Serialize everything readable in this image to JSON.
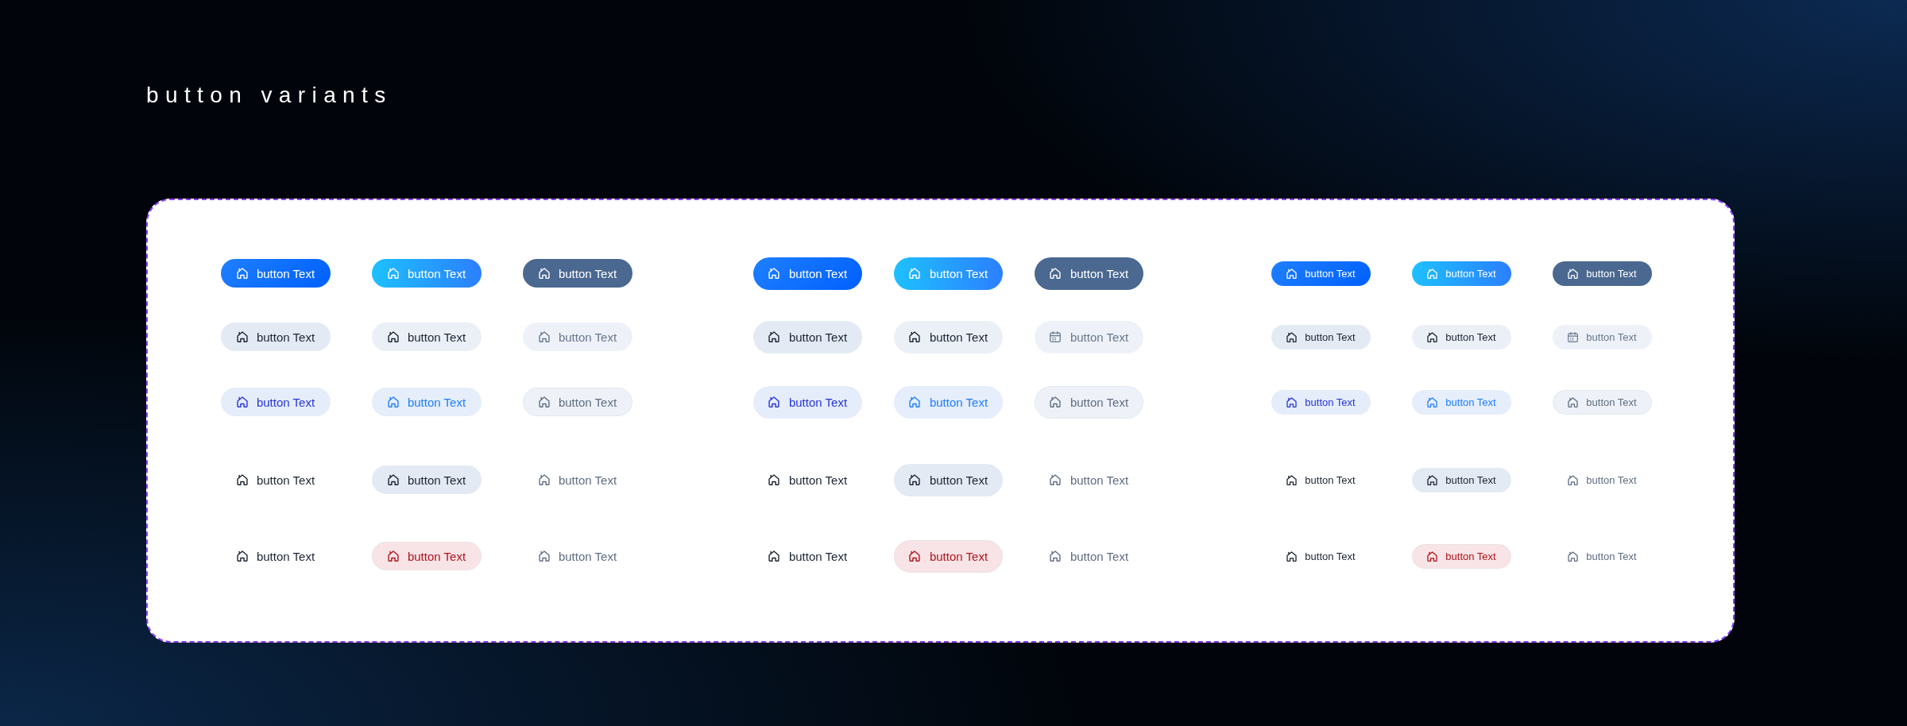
{
  "title": "button variants",
  "groups": [
    {
      "kind": "medium",
      "rows": [
        {
          "buttons": [
            {
              "label": "button Text",
              "kind": "filled"
            },
            {
              "label": "button Text",
              "kind": "gradient"
            },
            {
              "label": "button Text",
              "kind": "muted"
            }
          ]
        },
        {
          "buttons": [
            {
              "label": "button Text",
              "kind": "tonal"
            },
            {
              "label": "button Text",
              "kind": "tonal-light"
            },
            {
              "label": "button Text",
              "kind": "disabled"
            }
          ]
        },
        {
          "buttons": [
            {
              "label": "button Text",
              "kind": "soft-primary"
            },
            {
              "label": "button Text",
              "kind": "soft-accent"
            },
            {
              "label": "button Text",
              "kind": "soft-disabled"
            }
          ]
        },
        {
          "buttons": [
            {
              "label": "button Text",
              "kind": "text"
            },
            {
              "label": "button Text",
              "kind": "tonal"
            },
            {
              "label": "button Text",
              "kind": "text-disabled"
            }
          ]
        },
        {
          "buttons": [
            {
              "label": "button Text",
              "kind": "text"
            },
            {
              "label": "button Text",
              "kind": "soft-danger"
            },
            {
              "label": "button Text",
              "kind": "text-disabled"
            }
          ]
        }
      ]
    },
    {
      "kind": "large",
      "rows": [
        {
          "buttons": [
            {
              "label": "button Text",
              "kind": "filled"
            },
            {
              "label": "button Text",
              "kind": "gradient"
            },
            {
              "label": "button Text",
              "kind": "muted"
            }
          ]
        },
        {
          "buttons": [
            {
              "label": "button Text",
              "kind": "tonal"
            },
            {
              "label": "button Text",
              "kind": "tonal-light"
            },
            {
              "label": "button Text",
              "kind": "disabled-calendar"
            }
          ]
        },
        {
          "buttons": [
            {
              "label": "button Text",
              "kind": "soft-primary"
            },
            {
              "label": "button Text",
              "kind": "soft-accent"
            },
            {
              "label": "button Text",
              "kind": "soft-disabled"
            }
          ]
        },
        {
          "buttons": [
            {
              "label": "button Text",
              "kind": "text"
            },
            {
              "label": "button Text",
              "kind": "tonal"
            },
            {
              "label": "button Text",
              "kind": "text-disabled"
            }
          ]
        },
        {
          "buttons": [
            {
              "label": "button Text",
              "kind": "text"
            },
            {
              "label": "button Text",
              "kind": "soft-danger"
            },
            {
              "label": "button Text",
              "kind": "text-disabled"
            }
          ]
        }
      ]
    },
    {
      "kind": "small",
      "rows": [
        {
          "buttons": [
            {
              "label": "button Text",
              "kind": "filled"
            },
            {
              "label": "button Text",
              "kind": "gradient"
            },
            {
              "label": "button Text",
              "kind": "muted"
            }
          ]
        },
        {
          "buttons": [
            {
              "label": "button Text",
              "kind": "tonal"
            },
            {
              "label": "button Text",
              "kind": "tonal-light"
            },
            {
              "label": "button Text",
              "kind": "disabled-calendar"
            }
          ]
        },
        {
          "buttons": [
            {
              "label": "button Text",
              "kind": "soft-primary"
            },
            {
              "label": "button Text",
              "kind": "soft-accent"
            },
            {
              "label": "button Text",
              "kind": "soft-disabled"
            }
          ]
        },
        {
          "buttons": [
            {
              "label": "button Text",
              "kind": "text"
            },
            {
              "label": "button Text",
              "kind": "tonal"
            },
            {
              "label": "button Text",
              "kind": "text-disabled"
            }
          ]
        },
        {
          "buttons": [
            {
              "label": "button Text",
              "kind": "text"
            },
            {
              "label": "button Text",
              "kind": "soft-danger"
            },
            {
              "label": "button Text",
              "kind": "text-disabled"
            }
          ]
        }
      ]
    }
  ]
}
